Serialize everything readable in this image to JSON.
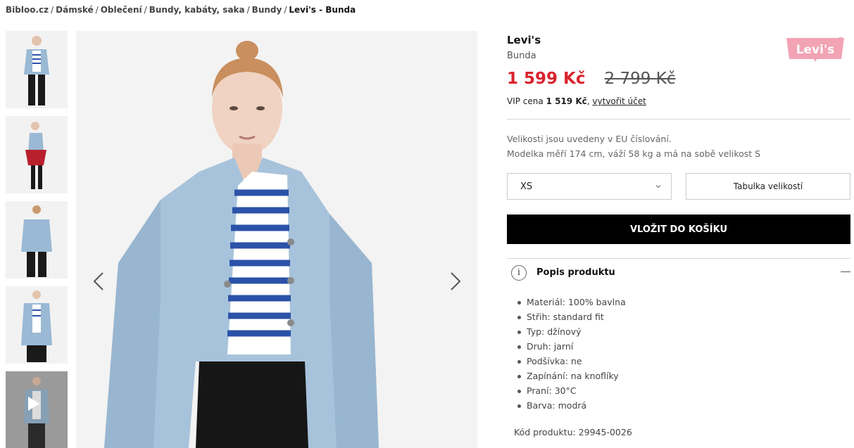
{
  "breadcrumb": {
    "items": [
      "Bibloo.cz",
      "Dámské",
      "Oblečení",
      "Bundy, kabáty, saka",
      "Bundy"
    ],
    "separator": "/",
    "current": "Levi's - Bunda"
  },
  "gallery": {
    "thumbnails": [
      "front",
      "side",
      "back",
      "detail",
      "video"
    ],
    "selected_index": 0
  },
  "product": {
    "brand": "Levi's",
    "name": "Bunda",
    "logo_text": "Levi's",
    "price": "1 599 Kč",
    "old_price": "2 799 Kč",
    "vip_prefix": "VIP cena",
    "vip_price": "1 519 Kč",
    "vip_sep": ",",
    "vip_link": "vytvořit účet",
    "size_note_1": "Velikosti jsou uvedeny v EU číslování.",
    "size_note_2": "Modelka měří 174 cm, váží 58 kg a má na sobě velikost S",
    "selected_size": "XS",
    "size_table_label": "Tabulka velikostí",
    "cart_button": "VLOŽIT DO KOŠÍKU",
    "description_title": "Popis produktu",
    "info_icon_glyph": "i",
    "properties": [
      "Materiál: 100% bavlna",
      "Střih: standard fit",
      "Typ: džínový",
      "Druh: jarní",
      "Podšívka: ne",
      "Zapínání: na knoflíky",
      "Praní: 30°C",
      "Barva: modrá"
    ],
    "product_code": "Kód produktu: 29945-0026"
  },
  "colors": {
    "price_red": "#d9232d",
    "logo_pink": "#f2a3b4",
    "button_black": "#000000"
  }
}
